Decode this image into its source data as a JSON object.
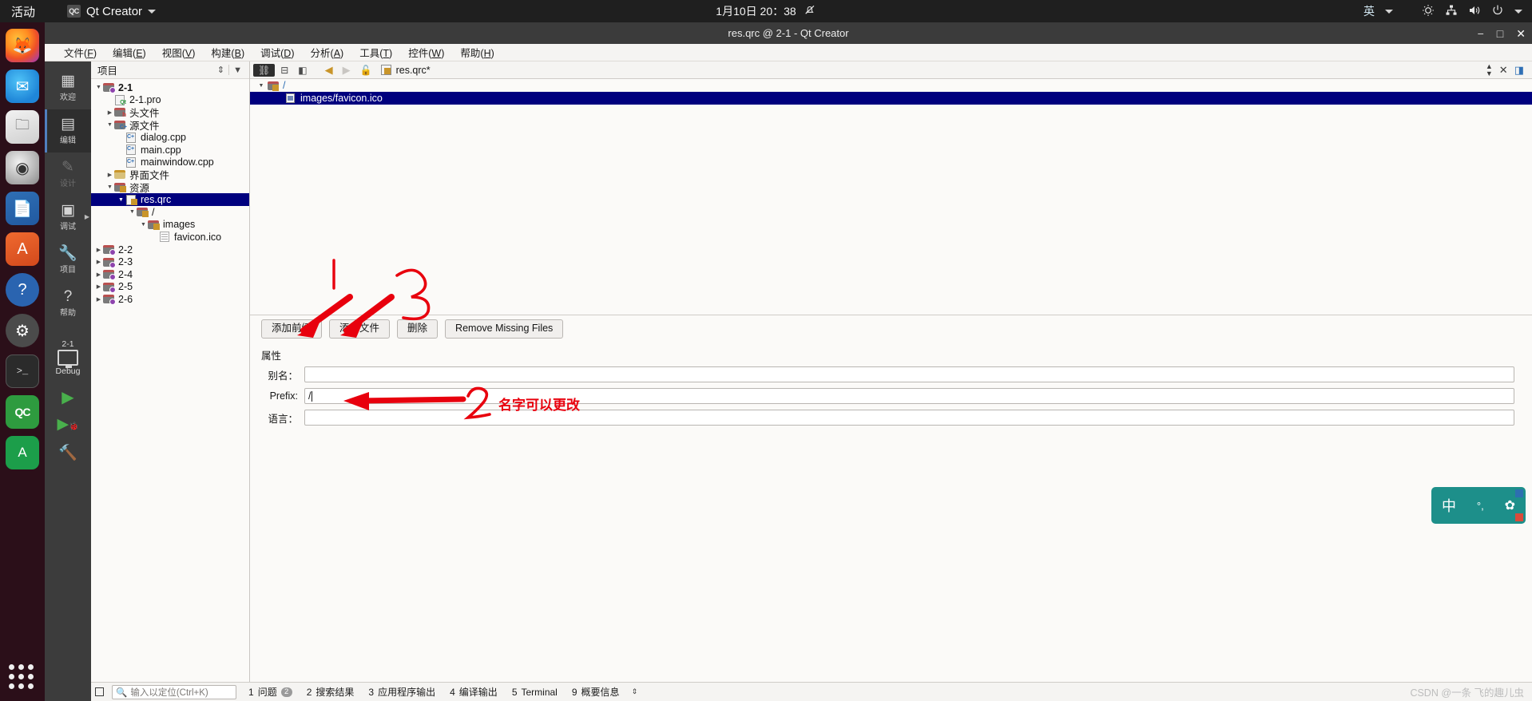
{
  "gnome": {
    "activities": "活动",
    "app_name": "Qt Creator",
    "app_icon": "qt-creator-icon",
    "clock": "1月10日  20：38",
    "notification_icon": "bell-muted-icon",
    "language": "英",
    "tray": [
      "night-light-icon",
      "network-icon",
      "volume-icon",
      "power-icon"
    ]
  },
  "dock": {
    "items": [
      {
        "name": "firefox",
        "glyph": "🦊"
      },
      {
        "name": "thunderbird",
        "glyph": "✉"
      },
      {
        "name": "files",
        "glyph": "🗀"
      },
      {
        "name": "rhythmbox",
        "glyph": "♪"
      },
      {
        "name": "libreoffice-writer",
        "glyph": "📄"
      },
      {
        "name": "ubuntu-software",
        "glyph": "A"
      },
      {
        "name": "help",
        "glyph": "?"
      },
      {
        "name": "settings",
        "glyph": "⚙"
      },
      {
        "name": "terminal",
        "glyph": ">_"
      },
      {
        "name": "qt-creator",
        "glyph": "QC"
      },
      {
        "name": "anaconda",
        "glyph": "A"
      }
    ],
    "show_apps": "show-applications"
  },
  "window": {
    "title": "res.qrc @ 2-1 - Qt Creator",
    "minimize": "−",
    "maximize": "□",
    "close": "✕"
  },
  "menubar": [
    {
      "label": "文件",
      "accel": "F"
    },
    {
      "label": "编辑",
      "accel": "E"
    },
    {
      "label": "视图",
      "accel": "V"
    },
    {
      "label": "构建",
      "accel": "B"
    },
    {
      "label": "调试",
      "accel": "D"
    },
    {
      "label": "分析",
      "accel": "A"
    },
    {
      "label": "工具",
      "accel": "T"
    },
    {
      "label": "控件",
      "accel": "W"
    },
    {
      "label": "帮助",
      "accel": "H"
    }
  ],
  "modes": [
    {
      "label": "欢迎",
      "glyph": "▦",
      "active": false,
      "dim": false
    },
    {
      "label": "编辑",
      "glyph": "▤",
      "active": true,
      "dim": false
    },
    {
      "label": "设计",
      "glyph": "✎",
      "active": false,
      "dim": true
    },
    {
      "label": "调试",
      "glyph": "▣",
      "active": false,
      "dim": false
    },
    {
      "label": "项目",
      "glyph": "🔧",
      "active": false,
      "dim": false
    },
    {
      "label": "帮助",
      "glyph": "?",
      "active": false,
      "dim": false
    }
  ],
  "kit": {
    "name": "2-1",
    "build_mode": "Debug",
    "run_glyph": "▶",
    "debug_glyph": "▶",
    "build_glyph": "🔨"
  },
  "project_panel": {
    "header": "项目",
    "sync_icon": "sync-arrows-icon",
    "filter_icon": "filter-icon",
    "tree": [
      {
        "label": "2-1",
        "indent": 0,
        "arrow": "▼",
        "icon": "project-folder",
        "bold": true,
        "selected": false
      },
      {
        "label": "2-1.pro",
        "indent": 1,
        "arrow": "",
        "icon": "qt-pro-file",
        "bold": false,
        "selected": false
      },
      {
        "label": "头文件",
        "indent": 1,
        "arrow": "▶",
        "icon": "header-folder",
        "bold": false,
        "selected": false
      },
      {
        "label": "源文件",
        "indent": 1,
        "arrow": "▼",
        "icon": "source-folder",
        "bold": false,
        "selected": false
      },
      {
        "label": "dialog.cpp",
        "indent": 2,
        "arrow": "",
        "icon": "cpp-file",
        "bold": false,
        "selected": false
      },
      {
        "label": "main.cpp",
        "indent": 2,
        "arrow": "",
        "icon": "cpp-file",
        "bold": false,
        "selected": false
      },
      {
        "label": "mainwindow.cpp",
        "indent": 2,
        "arrow": "",
        "icon": "cpp-file",
        "bold": false,
        "selected": false
      },
      {
        "label": "界面文件",
        "indent": 1,
        "arrow": "▶",
        "icon": "ui-folder",
        "bold": false,
        "selected": false
      },
      {
        "label": "资源",
        "indent": 1,
        "arrow": "▼",
        "icon": "res-folder",
        "bold": false,
        "selected": false
      },
      {
        "label": "res.qrc",
        "indent": 2,
        "arrow": "▼",
        "icon": "qrc-file",
        "bold": false,
        "selected": true
      },
      {
        "label": "/",
        "indent": 3,
        "arrow": "▼",
        "icon": "prefix-folder",
        "bold": false,
        "selected": false
      },
      {
        "label": "images",
        "indent": 4,
        "arrow": "▼",
        "icon": "prefix-folder",
        "bold": false,
        "selected": false
      },
      {
        "label": "favicon.ico",
        "indent": 5,
        "arrow": "",
        "icon": "file-icon",
        "bold": false,
        "selected": false
      },
      {
        "label": "2-2",
        "indent": 0,
        "arrow": "▶",
        "icon": "project-folder",
        "bold": false,
        "selected": false
      },
      {
        "label": "2-3",
        "indent": 0,
        "arrow": "▶",
        "icon": "project-folder",
        "bold": false,
        "selected": false
      },
      {
        "label": "2-4",
        "indent": 0,
        "arrow": "▶",
        "icon": "project-folder",
        "bold": false,
        "selected": false
      },
      {
        "label": "2-5",
        "indent": 0,
        "arrow": "▶",
        "icon": "project-folder",
        "bold": false,
        "selected": false
      },
      {
        "label": "2-6",
        "indent": 0,
        "arrow": "▶",
        "icon": "project-folder",
        "bold": false,
        "selected": false
      }
    ]
  },
  "editor_toolbar": {
    "link_icon": "link-editors-icon",
    "split_icon": "split-editor-icon",
    "close_split_icon": "close-split-icon",
    "back_icon": "◀",
    "forward_icon": "▶",
    "lock_icon": "unlocked-icon",
    "file_icon": "qrc-file-icon",
    "file_name": "res.qrc*",
    "selector_icon": "updown-arrows-icon",
    "close_icon": "✕",
    "split_button_icon": "split-icon",
    "right_split_icon": "collapse-icon"
  },
  "resource_tree": [
    {
      "label": "/",
      "indent": 0,
      "arrow": "▼",
      "icon": "prefix-folder-icon",
      "selected": false
    },
    {
      "label": "images/favicon.ico",
      "indent": 1,
      "arrow": "",
      "icon": "image-file-icon",
      "selected": true
    }
  ],
  "buttons": [
    {
      "label": "添加前缀",
      "name": "add-prefix-button"
    },
    {
      "label": "添加文件",
      "name": "add-file-button"
    },
    {
      "label": "删除",
      "name": "remove-button"
    },
    {
      "label": "Remove Missing Files",
      "name": "remove-missing-files-button"
    }
  ],
  "properties": {
    "title": "属性",
    "rows": [
      {
        "label": "别名：",
        "value": "",
        "name": "alias-field"
      },
      {
        "label": "Prefix:",
        "value": "/",
        "name": "prefix-field"
      },
      {
        "label": "语言：",
        "value": "",
        "name": "language-field"
      }
    ]
  },
  "statusbar": {
    "toggle_icon": "toggle-sidebar-icon",
    "locator_placeholder": "输入以定位(Ctrl+K)",
    "locator_icon": "search-icon",
    "items": [
      {
        "num": "1",
        "label": "问题",
        "badge": "2"
      },
      {
        "num": "2",
        "label": "搜索结果",
        "badge": ""
      },
      {
        "num": "3",
        "label": "应用程序输出",
        "badge": ""
      },
      {
        "num": "4",
        "label": "编译输出",
        "badge": ""
      },
      {
        "num": "5",
        "label": "Terminal",
        "badge": ""
      },
      {
        "num": "9",
        "label": "概要信息",
        "badge": ""
      }
    ],
    "resize_icon": "updown-arrows-icon"
  },
  "annotations": {
    "label_text": "名字可以更改",
    "mark_1": "1",
    "mark_3": "3",
    "mark_2": "2",
    "color": "#e8000d"
  },
  "ime": {
    "mode": "中",
    "punct": "°,",
    "extra_icon": "flower-icon"
  },
  "watermark": "CSDN @一条 飞的趣儿虫"
}
